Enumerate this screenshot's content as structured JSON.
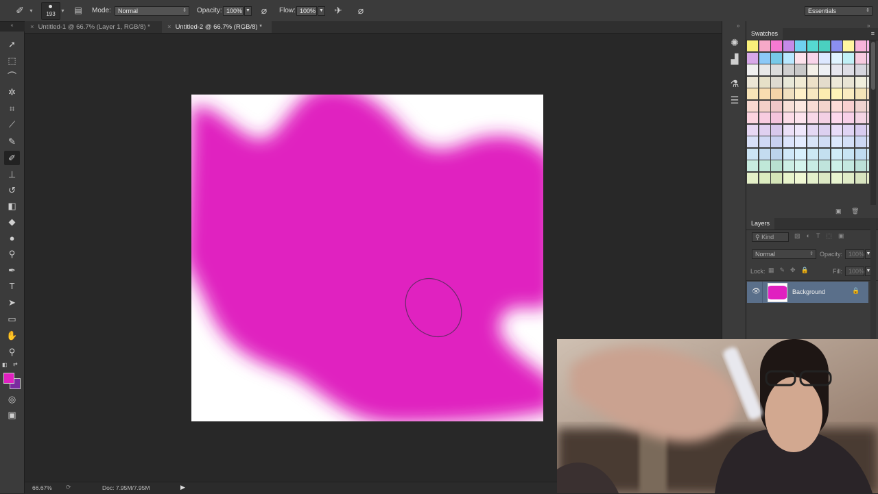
{
  "options_bar": {
    "brush_size": "193",
    "mode_label": "Mode:",
    "mode_value": "Normal",
    "opacity_label": "Opacity:",
    "opacity_value": "100%",
    "flow_label": "Flow:",
    "flow_value": "100%",
    "workspace": "Essentials"
  },
  "tabs": [
    {
      "label": "Untitled-1 @ 66.7% (Layer 1, RGB/8) *",
      "active": false
    },
    {
      "label": "Untitled-2 @ 66.7% (RGB/8) *",
      "active": true
    }
  ],
  "tools": [
    {
      "name": "move-tool",
      "glyph": "➚"
    },
    {
      "name": "marquee-tool",
      "glyph": "⬚"
    },
    {
      "name": "lasso-tool",
      "glyph": "⌒"
    },
    {
      "name": "quick-select-tool",
      "glyph": "✲"
    },
    {
      "name": "crop-tool",
      "glyph": "⌗"
    },
    {
      "name": "eyedropper-tool",
      "glyph": "⟋"
    },
    {
      "name": "healing-brush-tool",
      "glyph": "✎"
    },
    {
      "name": "brush-tool",
      "glyph": "✐"
    },
    {
      "name": "clone-stamp-tool",
      "glyph": "⊥"
    },
    {
      "name": "history-brush-tool",
      "glyph": "↺"
    },
    {
      "name": "eraser-tool",
      "glyph": "◧"
    },
    {
      "name": "paint-bucket-tool",
      "glyph": "◆"
    },
    {
      "name": "blur-tool",
      "glyph": "●"
    },
    {
      "name": "dodge-tool",
      "glyph": "⚲"
    },
    {
      "name": "pen-tool",
      "glyph": "✒"
    },
    {
      "name": "type-tool",
      "glyph": "T"
    },
    {
      "name": "path-select-tool",
      "glyph": "➤"
    },
    {
      "name": "shape-tool",
      "glyph": "▭"
    },
    {
      "name": "hand-tool",
      "glyph": "✋"
    },
    {
      "name": "zoom-tool",
      "glyph": "⚲"
    }
  ],
  "colors": {
    "foreground": "#e020c0",
    "background": "#7a2aa0",
    "paint": "#e020c0"
  },
  "status_bar": {
    "zoom": "66.67%",
    "doc_info": "Doc: 7.95M/7.95M"
  },
  "swatches": {
    "title": "Swatches",
    "colors": [
      [
        "#f9f07a",
        "#f6a9c8",
        "#f57ad2",
        "#c58ae8",
        "#6fd1f0",
        "#55d9d2",
        "#4ad0c0",
        "#8b8ff0",
        "#fff5a0",
        "#f7b3d9",
        "#fbb6e8",
        "#a8e0ff"
      ],
      [
        "#d7a8e8",
        "#8cc9f7",
        "#77c9e8",
        "#b8e8ff",
        "#fde2ec",
        "#f9d4ea",
        "#dde8ff",
        "#e0f4ff",
        "#c0f0f6",
        "#f7cbe0",
        "#f5d0f5",
        "#f9dcee"
      ],
      [
        "#f0f0f0",
        "#e8e8e8",
        "#dcdcdc",
        "#d0d0d0",
        "#c8c8c8",
        "#f4f0e8",
        "#eef0f4",
        "#e6e6ee",
        "#dedee6",
        "#d6d6de",
        "#cecece",
        "#c6c6c6"
      ],
      [
        "#ece6d6",
        "#e6e0c8",
        "#dedad0",
        "#e8e8d8",
        "#f0ead4",
        "#ece0c8",
        "#e4dccc",
        "#ece8d8",
        "#e8e4d4",
        "#f0eedc",
        "#e8e8e0",
        "#dcdcd4"
      ],
      [
        "#f8e4b8",
        "#f8dcb0",
        "#f4d4a8",
        "#f0e0c0",
        "#fff0c8",
        "#f8e8c0",
        "#fcecb0",
        "#fef4b8",
        "#faecc0",
        "#f4e4b8",
        "#f0dcc0",
        "#ece0c8"
      ],
      [
        "#f8d8d0",
        "#f4d0c8",
        "#f0c8c8",
        "#f8e0d8",
        "#fce8e0",
        "#f8dcd4",
        "#f4d4cc",
        "#fcdcd8",
        "#f8d0d0",
        "#f0d4d0",
        "#f4dcd8",
        "#ecd4d0"
      ],
      [
        "#fcd4e0",
        "#f8cce0",
        "#f4c4dc",
        "#fcdce8",
        "#fde4ee",
        "#f8d8e8",
        "#f4d0e4",
        "#fcd8ec",
        "#f8d0e8",
        "#f4d4e4",
        "#f0d0e0",
        "#f8dcec"
      ],
      [
        "#e8d8f4",
        "#e0d0f0",
        "#d8c8ec",
        "#ece0f8",
        "#f0e8fc",
        "#e4d8f4",
        "#dcd0f0",
        "#e8dcf8",
        "#e0d4f4",
        "#d8ccf0",
        "#e4dcf4",
        "#dcd4ec"
      ],
      [
        "#d8e0f8",
        "#d0d8f4",
        "#c8d0f0",
        "#dce4fc",
        "#e4ecff",
        "#d8e4f8",
        "#d0dcf4",
        "#dce8fc",
        "#d4e0f8",
        "#ccd8f4",
        "#d8e0f4",
        "#d0d8ec"
      ],
      [
        "#cce4f4",
        "#c4dcf0",
        "#bcd4ec",
        "#d0e8f8",
        "#d8f0fc",
        "#cce8f4",
        "#c4e0f0",
        "#d0ecf8",
        "#c8e4f4",
        "#c0dcf0",
        "#cce4f0",
        "#c4dcec"
      ],
      [
        "#c8ece0",
        "#c0e8d8",
        "#b8e0d0",
        "#cceee4",
        "#d4f4ec",
        "#c8ece4",
        "#c0e4dc",
        "#ccf0e8",
        "#c4e8e0",
        "#bce0d8",
        "#c8e8e0",
        "#c0e0d8"
      ],
      [
        "#e4f0c8",
        "#dcecc0",
        "#d4e4b8",
        "#e8f4cc",
        "#f0f8d4",
        "#e4f0cc",
        "#dce8c4",
        "#e8f4d0",
        "#e0ecc8",
        "#d8e4c0",
        "#e4ecc8",
        "#dce4c0"
      ]
    ]
  },
  "layers": {
    "title": "Layers",
    "filter_label": "Kind",
    "blend_mode": "Normal",
    "opacity_label": "Opacity:",
    "opacity_value": "100%",
    "lock_label": "Lock:",
    "fill_label": "Fill:",
    "fill_value": "100%",
    "items": [
      {
        "name": "Background",
        "visible": true,
        "locked": true
      }
    ]
  }
}
